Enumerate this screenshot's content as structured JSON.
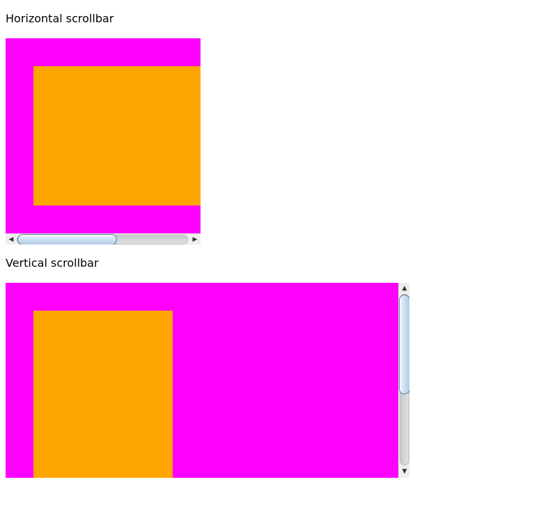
{
  "sections": {
    "horizontal": {
      "label": "Horizontal scrollbar"
    },
    "vertical": {
      "label": "Vertical scrollbar"
    }
  },
  "colors": {
    "outer": "#ff00ff",
    "inner": "#ffa500"
  },
  "icons": {
    "left": "◀",
    "right": "▶",
    "up": "▲",
    "down": "▼"
  }
}
